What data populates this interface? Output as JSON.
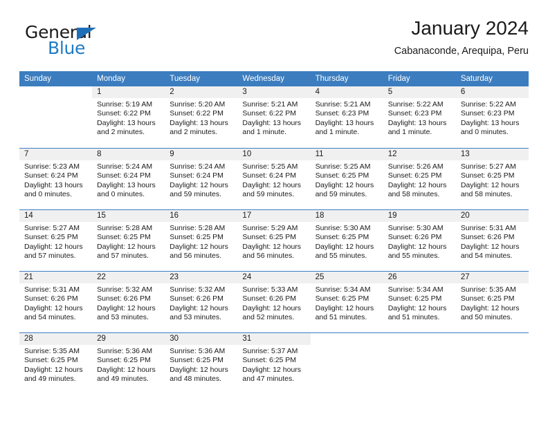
{
  "brand": {
    "name_part1": "General",
    "name_part2": "Blue",
    "logo_icon": "triangle-icon"
  },
  "header": {
    "title": "January 2024",
    "subtitle": "Cabanaconde, Arequipa, Peru"
  },
  "calendar": {
    "weekdays": [
      "Sunday",
      "Monday",
      "Tuesday",
      "Wednesday",
      "Thursday",
      "Friday",
      "Saturday"
    ],
    "header_bg": "#3b7dbf",
    "day_number_bg": "#f0f0f0",
    "weeks": [
      [
        {
          "day": "",
          "sunrise": "",
          "sunset": "",
          "daylight": ""
        },
        {
          "day": "1",
          "sunrise": "Sunrise: 5:19 AM",
          "sunset": "Sunset: 6:22 PM",
          "daylight": "Daylight: 13 hours and 2 minutes."
        },
        {
          "day": "2",
          "sunrise": "Sunrise: 5:20 AM",
          "sunset": "Sunset: 6:22 PM",
          "daylight": "Daylight: 13 hours and 2 minutes."
        },
        {
          "day": "3",
          "sunrise": "Sunrise: 5:21 AM",
          "sunset": "Sunset: 6:22 PM",
          "daylight": "Daylight: 13 hours and 1 minute."
        },
        {
          "day": "4",
          "sunrise": "Sunrise: 5:21 AM",
          "sunset": "Sunset: 6:23 PM",
          "daylight": "Daylight: 13 hours and 1 minute."
        },
        {
          "day": "5",
          "sunrise": "Sunrise: 5:22 AM",
          "sunset": "Sunset: 6:23 PM",
          "daylight": "Daylight: 13 hours and 1 minute."
        },
        {
          "day": "6",
          "sunrise": "Sunrise: 5:22 AM",
          "sunset": "Sunset: 6:23 PM",
          "daylight": "Daylight: 13 hours and 0 minutes."
        }
      ],
      [
        {
          "day": "7",
          "sunrise": "Sunrise: 5:23 AM",
          "sunset": "Sunset: 6:24 PM",
          "daylight": "Daylight: 13 hours and 0 minutes."
        },
        {
          "day": "8",
          "sunrise": "Sunrise: 5:24 AM",
          "sunset": "Sunset: 6:24 PM",
          "daylight": "Daylight: 13 hours and 0 minutes."
        },
        {
          "day": "9",
          "sunrise": "Sunrise: 5:24 AM",
          "sunset": "Sunset: 6:24 PM",
          "daylight": "Daylight: 12 hours and 59 minutes."
        },
        {
          "day": "10",
          "sunrise": "Sunrise: 5:25 AM",
          "sunset": "Sunset: 6:24 PM",
          "daylight": "Daylight: 12 hours and 59 minutes."
        },
        {
          "day": "11",
          "sunrise": "Sunrise: 5:25 AM",
          "sunset": "Sunset: 6:25 PM",
          "daylight": "Daylight: 12 hours and 59 minutes."
        },
        {
          "day": "12",
          "sunrise": "Sunrise: 5:26 AM",
          "sunset": "Sunset: 6:25 PM",
          "daylight": "Daylight: 12 hours and 58 minutes."
        },
        {
          "day": "13",
          "sunrise": "Sunrise: 5:27 AM",
          "sunset": "Sunset: 6:25 PM",
          "daylight": "Daylight: 12 hours and 58 minutes."
        }
      ],
      [
        {
          "day": "14",
          "sunrise": "Sunrise: 5:27 AM",
          "sunset": "Sunset: 6:25 PM",
          "daylight": "Daylight: 12 hours and 57 minutes."
        },
        {
          "day": "15",
          "sunrise": "Sunrise: 5:28 AM",
          "sunset": "Sunset: 6:25 PM",
          "daylight": "Daylight: 12 hours and 57 minutes."
        },
        {
          "day": "16",
          "sunrise": "Sunrise: 5:28 AM",
          "sunset": "Sunset: 6:25 PM",
          "daylight": "Daylight: 12 hours and 56 minutes."
        },
        {
          "day": "17",
          "sunrise": "Sunrise: 5:29 AM",
          "sunset": "Sunset: 6:25 PM",
          "daylight": "Daylight: 12 hours and 56 minutes."
        },
        {
          "day": "18",
          "sunrise": "Sunrise: 5:30 AM",
          "sunset": "Sunset: 6:25 PM",
          "daylight": "Daylight: 12 hours and 55 minutes."
        },
        {
          "day": "19",
          "sunrise": "Sunrise: 5:30 AM",
          "sunset": "Sunset: 6:26 PM",
          "daylight": "Daylight: 12 hours and 55 minutes."
        },
        {
          "day": "20",
          "sunrise": "Sunrise: 5:31 AM",
          "sunset": "Sunset: 6:26 PM",
          "daylight": "Daylight: 12 hours and 54 minutes."
        }
      ],
      [
        {
          "day": "21",
          "sunrise": "Sunrise: 5:31 AM",
          "sunset": "Sunset: 6:26 PM",
          "daylight": "Daylight: 12 hours and 54 minutes."
        },
        {
          "day": "22",
          "sunrise": "Sunrise: 5:32 AM",
          "sunset": "Sunset: 6:26 PM",
          "daylight": "Daylight: 12 hours and 53 minutes."
        },
        {
          "day": "23",
          "sunrise": "Sunrise: 5:32 AM",
          "sunset": "Sunset: 6:26 PM",
          "daylight": "Daylight: 12 hours and 53 minutes."
        },
        {
          "day": "24",
          "sunrise": "Sunrise: 5:33 AM",
          "sunset": "Sunset: 6:26 PM",
          "daylight": "Daylight: 12 hours and 52 minutes."
        },
        {
          "day": "25",
          "sunrise": "Sunrise: 5:34 AM",
          "sunset": "Sunset: 6:25 PM",
          "daylight": "Daylight: 12 hours and 51 minutes."
        },
        {
          "day": "26",
          "sunrise": "Sunrise: 5:34 AM",
          "sunset": "Sunset: 6:25 PM",
          "daylight": "Daylight: 12 hours and 51 minutes."
        },
        {
          "day": "27",
          "sunrise": "Sunrise: 5:35 AM",
          "sunset": "Sunset: 6:25 PM",
          "daylight": "Daylight: 12 hours and 50 minutes."
        }
      ],
      [
        {
          "day": "28",
          "sunrise": "Sunrise: 5:35 AM",
          "sunset": "Sunset: 6:25 PM",
          "daylight": "Daylight: 12 hours and 49 minutes."
        },
        {
          "day": "29",
          "sunrise": "Sunrise: 5:36 AM",
          "sunset": "Sunset: 6:25 PM",
          "daylight": "Daylight: 12 hours and 49 minutes."
        },
        {
          "day": "30",
          "sunrise": "Sunrise: 5:36 AM",
          "sunset": "Sunset: 6:25 PM",
          "daylight": "Daylight: 12 hours and 48 minutes."
        },
        {
          "day": "31",
          "sunrise": "Sunrise: 5:37 AM",
          "sunset": "Sunset: 6:25 PM",
          "daylight": "Daylight: 12 hours and 47 minutes."
        },
        {
          "day": "",
          "sunrise": "",
          "sunset": "",
          "daylight": ""
        },
        {
          "day": "",
          "sunrise": "",
          "sunset": "",
          "daylight": ""
        },
        {
          "day": "",
          "sunrise": "",
          "sunset": "",
          "daylight": ""
        }
      ]
    ]
  }
}
